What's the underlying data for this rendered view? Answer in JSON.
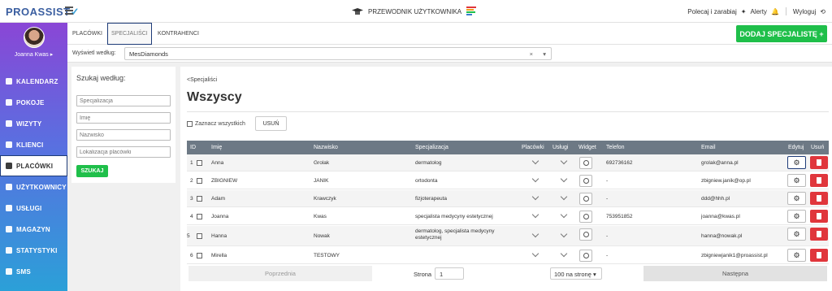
{
  "app": {
    "logo": "PROASSIST",
    "guide": "PRZEWODNIK UŻYTKOWNIKA",
    "refer": "Polecaj i zarabiaj",
    "alerts": "Alerty",
    "logout": "Wyloguj"
  },
  "sidebar": {
    "user": "Joanna Kwas ▸",
    "items": [
      {
        "label": "KALENDARZ",
        "icon": "calendar-icon"
      },
      {
        "label": "POKOJE",
        "icon": "door-icon"
      },
      {
        "label": "WIZYTY",
        "icon": "visits-icon"
      },
      {
        "label": "KLIENCI",
        "icon": "clients-icon"
      },
      {
        "label": "PLACÓWKI",
        "icon": "location-icon",
        "active": true
      },
      {
        "label": "UŻYTKOWNICY",
        "icon": "users-icon"
      },
      {
        "label": "USŁUGI",
        "icon": "grid-icon"
      },
      {
        "label": "MAGAZYN",
        "icon": "box-icon"
      },
      {
        "label": "STATYSTYKI",
        "icon": "chart-icon"
      },
      {
        "label": "SMS",
        "icon": "message-icon"
      }
    ]
  },
  "tabs": [
    "PLACÓWKI",
    "SPECJALIŚCI",
    "KONTRAHENCI"
  ],
  "add_button": "DODAJ SPECJALISTĘ +",
  "filter": {
    "label": "Wyświetl według:",
    "value": "MesDiamonds"
  },
  "search": {
    "title": "Szukaj według:",
    "placeholders": [
      "Specjalizacja",
      "Imię",
      "Nazwisko",
      "Lokalizacja placówki"
    ],
    "button": "SZUKAJ"
  },
  "main": {
    "breadcrumb": "<Specjaliści",
    "heading": "Wszyscy",
    "select_all": "Zaznacz wszystkich",
    "delete_all": "USUŃ",
    "columns": [
      "ID",
      "Imię",
      "Nazwisko",
      "Specjalizacja",
      "Placówki",
      "Usługi",
      "Widget",
      "Telefon",
      "Email",
      "Edytuj",
      "Usuń"
    ],
    "rows": [
      {
        "id": "1",
        "first": "Anna",
        "last": "Grolak",
        "spec": "dermatolog",
        "phone": "692736162",
        "email": "grolak@anna.pl"
      },
      {
        "id": "2",
        "first": "ZBIGNIEW",
        "last": "JANIK",
        "spec": "ortodonta",
        "phone": "-",
        "email": "zbigniew.janik@op.pl"
      },
      {
        "id": "3",
        "first": "Adam",
        "last": "Krawczyk",
        "spec": "fizjoterapeuta",
        "phone": "-",
        "email": "ddd@hhh.pl"
      },
      {
        "id": "4",
        "first": "Joanna",
        "last": "Kwas",
        "spec": "specjalista medycyny estetycznej",
        "phone": "753951852",
        "email": "joanna@kwas.pl"
      },
      {
        "id": "5",
        "first": "Hanna",
        "last": "Nowak",
        "spec": "dermatolog, specjalista medycyny estetycznej",
        "phone": "-",
        "email": "hanna@nowak.pl"
      },
      {
        "id": "6",
        "first": "Mirella",
        "last": "TESTOWY",
        "spec": "",
        "phone": "-",
        "email": "zbigniewjanik1@proassist.pl"
      }
    ]
  },
  "pager": {
    "prev": "Poprzednia",
    "page_label": "Strona",
    "page": "1",
    "per_page": "100 na stronę",
    "next": "Następna"
  },
  "colors": {
    "accent": "#1fbf4a",
    "danger": "#e0363c",
    "header": "#6d7985",
    "highlight": "#1e3b78"
  }
}
